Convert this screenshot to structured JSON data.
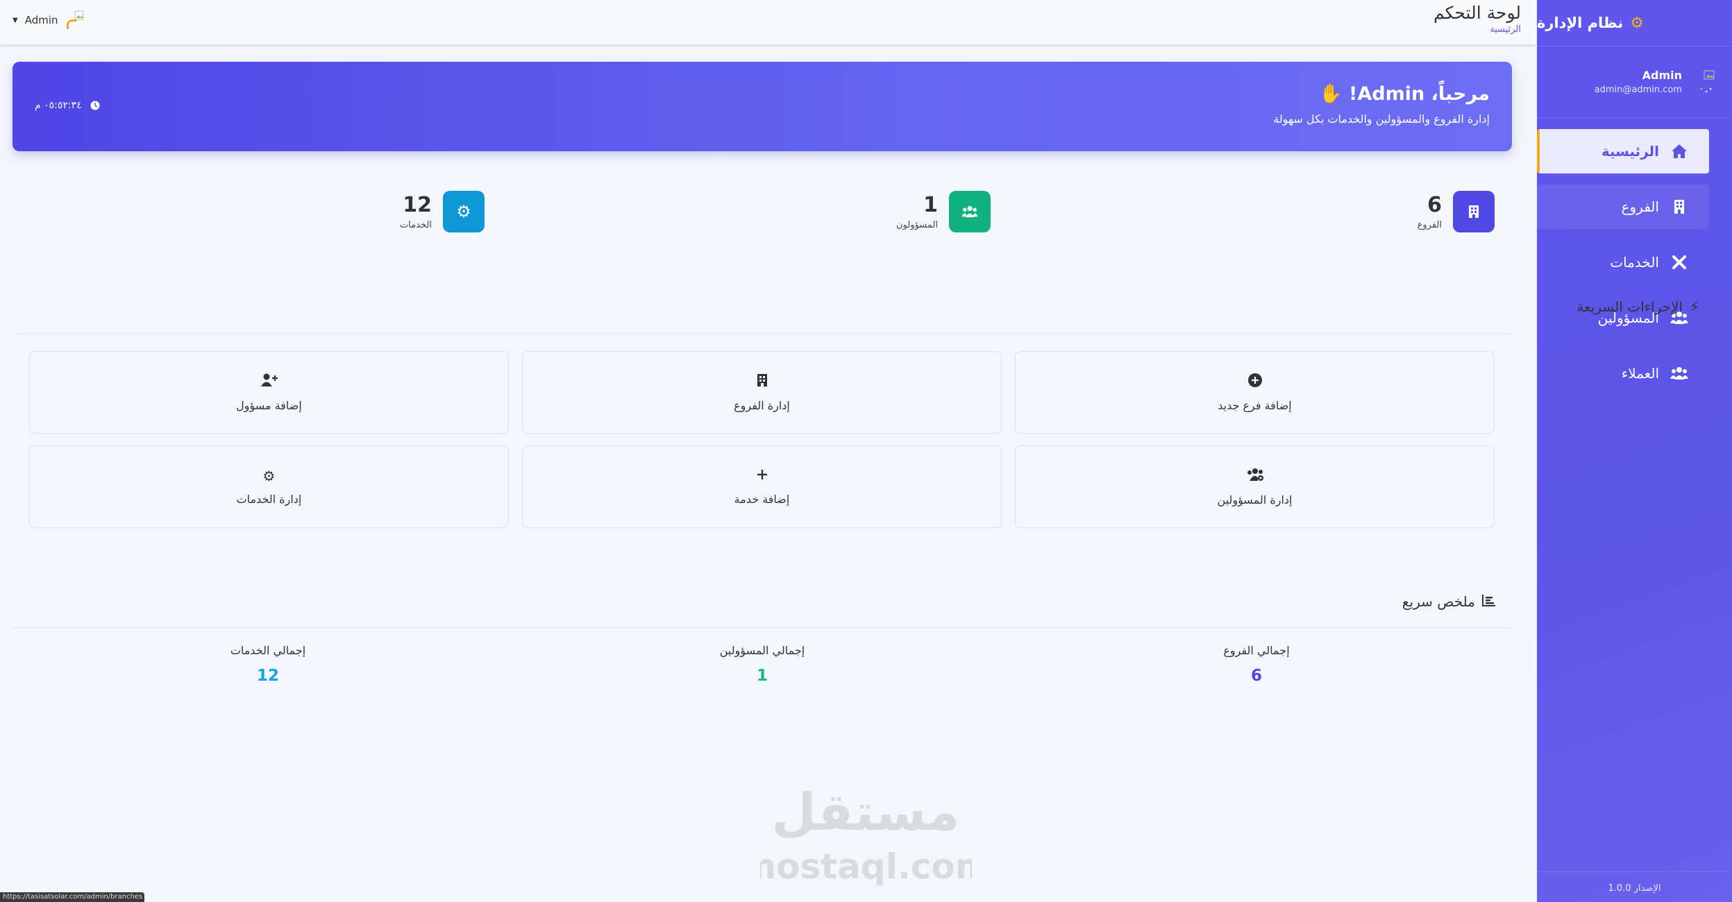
{
  "sidebar": {
    "brand": "نظام الإدارة",
    "user": {
      "name": "Admin",
      "email": "admin@admin.com"
    },
    "items": [
      {
        "label": "الرئيسية",
        "icon": "home-icon"
      },
      {
        "label": "الفروع",
        "icon": "building-icon"
      },
      {
        "label": "الخدمات",
        "icon": "tools-icon"
      },
      {
        "label": "المسؤولين",
        "icon": "users-icon"
      },
      {
        "label": "العملاء",
        "icon": "users-icon"
      }
    ],
    "version": "الإصدار 1.0.0"
  },
  "topbar": {
    "title": "لوحة التحكم",
    "breadcrumb": "الرئيسية",
    "user_label": "Admin"
  },
  "banner": {
    "title": "مرحباً، Admin!",
    "subtitle": "إدارة الفروع والمسؤولين والخدمات بكل سهولة",
    "time": "٠٥:٥٢:٣٤ م"
  },
  "stats": [
    {
      "value": "6",
      "label": "الفروع",
      "color": "#4f46e5",
      "icon": "building-icon"
    },
    {
      "value": "1",
      "label": "المسؤولون",
      "color": "#10b981",
      "icon": "users-icon"
    },
    {
      "value": "12",
      "label": "الخدمات",
      "color": "#0ea5e9",
      "icon": "cogs-icon"
    }
  ],
  "quick_actions": {
    "title": "الإجراءات السريعة",
    "items": [
      {
        "label": "إضافة فرع جديد",
        "icon": "plus-circle-icon"
      },
      {
        "label": "إدارة الفروع",
        "icon": "building-icon"
      },
      {
        "label": "إضافة مسؤول",
        "icon": "user-plus-icon"
      },
      {
        "label": "إدارة المسؤولين",
        "icon": "users-cog-icon"
      },
      {
        "label": "إضافة خدمة",
        "icon": "plus-icon"
      },
      {
        "label": "إدارة الخدمات",
        "icon": "cogs-icon"
      }
    ]
  },
  "summary": {
    "title": "ملخص سريع",
    "items": [
      {
        "label": "إجمالي الفروع",
        "value": "6",
        "color": "#4f46e5"
      },
      {
        "label": "إجمالي المسؤولين",
        "value": "1",
        "color": "#10b981"
      },
      {
        "label": "إجمالي الخدمات",
        "value": "12",
        "color": "#0ea5e9"
      }
    ]
  },
  "watermark": "مستقل mostaql.com",
  "status_url": "https://tasisatsolar.com/admin/branches",
  "colors": {
    "accent": "#5b55e6",
    "highlight": "#f5a623"
  }
}
